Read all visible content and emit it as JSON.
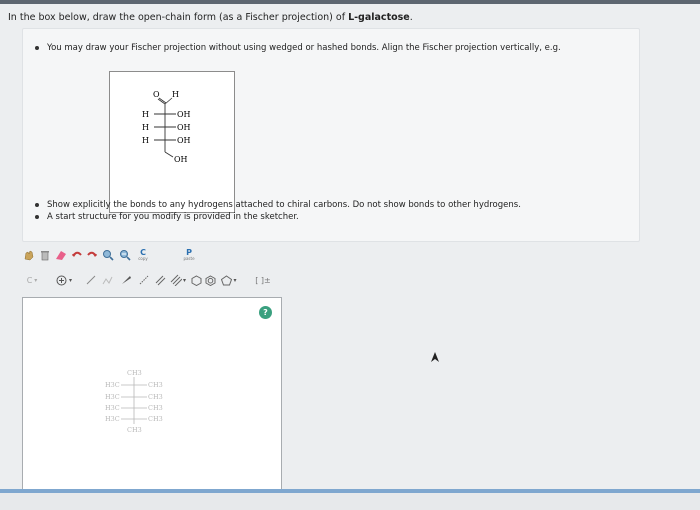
{
  "question": {
    "prefix": "In the box below, draw the open-chain form (as a Fischer projection) of ",
    "bold": "L-galactose",
    "suffix": "."
  },
  "instructions": {
    "line1": "You may draw your Fischer projection without using wedged or hashed bonds. Align the Fischer projection vertically, e.g.",
    "line2": "Show explicitly the bonds to any hydrogens attached to chiral carbons. Do not show bonds to other hydrogens.",
    "line3": "A start structure for you modify is provided in the sketcher."
  },
  "example_molecule": {
    "aldehyde_o": "O",
    "aldehyde_h": "H",
    "rows": [
      {
        "left": "H",
        "right": "OH"
      },
      {
        "left": "H",
        "right": "OH"
      },
      {
        "left": "H",
        "right": "OH"
      }
    ],
    "bottom": "OH"
  },
  "toolbar": {
    "copy_label": "C",
    "copy_sub": "copy",
    "paste_label": "P",
    "paste_sub": "paste",
    "element_label": "C",
    "bracket_label": "[ ]±"
  },
  "start_structure": {
    "top": "CH3",
    "rows": [
      {
        "left": "H3C",
        "right": "CH3"
      },
      {
        "left": "H3C",
        "right": "CH3"
      },
      {
        "left": "H3C",
        "right": "CH3"
      },
      {
        "left": "H3C",
        "right": "CH3"
      }
    ],
    "bottom": "CH3"
  },
  "help": "?",
  "colors": {
    "accent": "#3aa07f",
    "bottom_bar": "#7fa7cf",
    "top_bar": "#5d6670"
  }
}
